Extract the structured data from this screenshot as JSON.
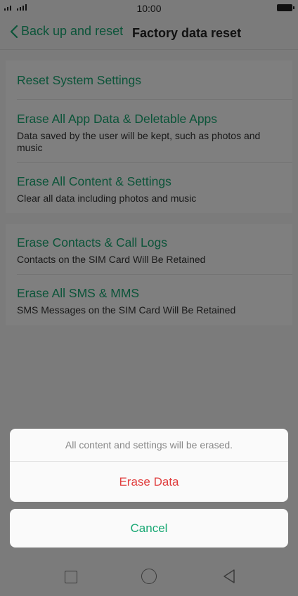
{
  "status_bar": {
    "time": "10:00"
  },
  "header": {
    "back_label": "Back up and reset",
    "title": "Factory data reset"
  },
  "options": [
    {
      "title": "Reset System Settings",
      "subtitle": ""
    },
    {
      "title": "Erase All App Data & Deletable Apps",
      "subtitle": "Data saved by the user will be kept, such as photos and music"
    },
    {
      "title": "Erase All Content & Settings",
      "subtitle": "Clear all data including photos and music"
    },
    {
      "title": "Erase Contacts & Call Logs",
      "subtitle": "Contacts on the SIM Card Will Be Retained"
    },
    {
      "title": "Erase All SMS & MMS",
      "subtitle": "SMS Messages on the SIM Card Will Be Retained"
    }
  ],
  "dialog": {
    "message": "All content and settings will be erased.",
    "confirm_label": "Erase Data",
    "cancel_label": "Cancel"
  },
  "colors": {
    "accent": "#18a873",
    "destructive": "#e03e3e"
  }
}
